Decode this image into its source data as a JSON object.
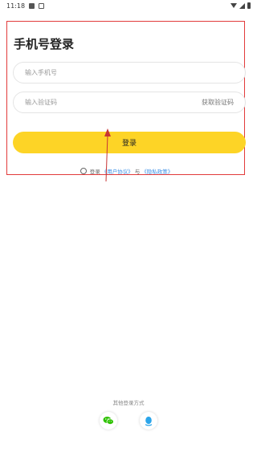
{
  "status_bar": {
    "time": "11:18"
  },
  "login": {
    "title": "手机号登录",
    "phone_placeholder": "输入手机号",
    "code_placeholder": "输入验证码",
    "get_code_label": "获取验证码",
    "login_button_label": "登录",
    "agreement": {
      "prefix": "登录",
      "user_agreement": "《用户协议》",
      "connector": "与",
      "privacy_policy": "《隐私政策》"
    }
  },
  "other_login": {
    "title": "其他登录方式",
    "options": [
      {
        "icon": "wechat-icon",
        "color": "#2dc100"
      },
      {
        "icon": "qq-icon",
        "color": "#2aa5ea"
      }
    ]
  },
  "colors": {
    "accent": "#fdd426",
    "annotation": "#e23b3b",
    "link": "#3a8ee6"
  }
}
